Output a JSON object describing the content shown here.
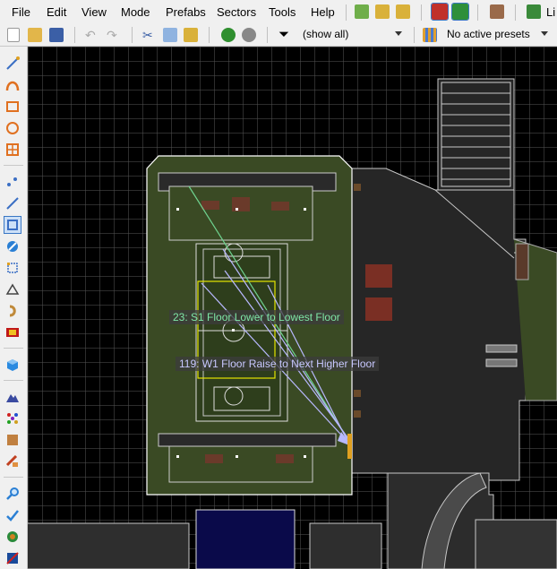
{
  "menu": {
    "file": "File",
    "edit": "Edit",
    "view": "View",
    "mode": "Mode",
    "prefabs": "Prefabs",
    "sectors": "Sectors",
    "tools": "Tools",
    "help": "Help"
  },
  "menu_overflow_label": "Li",
  "toolbar": {
    "filter_value": "(show all)",
    "presets_value": "No active presets"
  },
  "map": {
    "action_label_1": "23: S1 Floor Lower to Lowest Floor",
    "action_label_2": "119: W1 Floor Raise to Next Higher Floor"
  },
  "colors": {
    "selection_line": "#ffffff",
    "action_line_green": "#6fd38f",
    "action_line_blue": "#b8b8ff",
    "highlight_yellow": "#e6e600",
    "grass": "#3a4a24"
  }
}
